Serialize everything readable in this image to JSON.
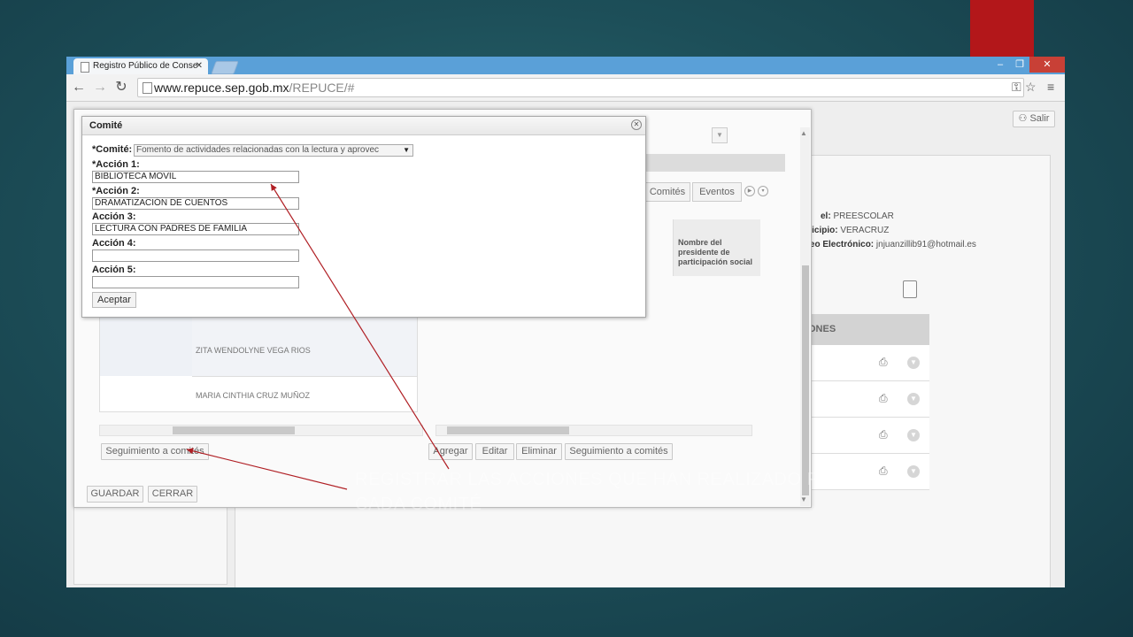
{
  "browser": {
    "tab_title": "Registro Público de Conse",
    "tab_close": "✕",
    "window_min": "–",
    "window_max": "❐",
    "window_close": "✕",
    "url_host": "www.repuce.sep.gob.mx",
    "url_path": "/REPUCE/#"
  },
  "page": {
    "salir_label": "Salir",
    "nivel_label": "el:",
    "nivel_value": "PREESCOLAR",
    "municipio_label": "nicipio:",
    "municipio_value": "VERACRUZ",
    "correo_label": "reo Electrónico:",
    "correo_value": "jnjuanzillib91@hotmail.es",
    "acciones_header": "ONES"
  },
  "modal": {
    "tab_comites": "Comités",
    "tab_eventos": "Eventos",
    "grid_header": "Nombre del presidente de participación social",
    "grid_rows": [
      "ZITA WENDOLYNE VEGA RIOS",
      "MARIA CINTHIA CRUZ MUÑOZ"
    ],
    "btn_seguimiento_left": "Seguimiento a comités",
    "btn_agregar": "Agregar",
    "btn_editar": "Editar",
    "btn_eliminar": "Eliminar",
    "btn_seguimiento_right": "Seguimiento a comités",
    "btn_guardar": "GUARDAR",
    "btn_cerrar": "CERRAR"
  },
  "dialog": {
    "title": "Comité",
    "comite_label": "*Comité:",
    "comite_value": "Fomento de actividades relacionadas con la lectura y aprovec",
    "acciones": [
      {
        "label": "*Acción 1:",
        "value": "BIBLIOTECA MOVIL"
      },
      {
        "label": "*Acción 2:",
        "value": "DRAMATIZACIÓN DE CUENTOS"
      },
      {
        "label": "Acción 3:",
        "value": "LECTURA CON PADRES DE FAMILIA"
      },
      {
        "label": "Acción 4:",
        "value": ""
      },
      {
        "label": "Acción 5:",
        "value": ""
      }
    ],
    "aceptar_label": "Aceptar"
  },
  "annotation": {
    "text": "REGISTRAR LAS ACCIONES QUE HAN REALIZADO POR CADA COMITÉ",
    "arrow_color": "#b01f24"
  },
  "colors": {
    "accent_red": "#b3171a",
    "titlebar_blue": "#5aa0d8"
  },
  "icons": [
    "page-icon",
    "back-icon",
    "forward-icon",
    "reload-icon",
    "key-icon",
    "star-icon",
    "menu-icon",
    "close-icon",
    "dropdown-arrow-icon",
    "print-icon",
    "chevron-down-icon",
    "clipboard-icon",
    "user-icon"
  ]
}
